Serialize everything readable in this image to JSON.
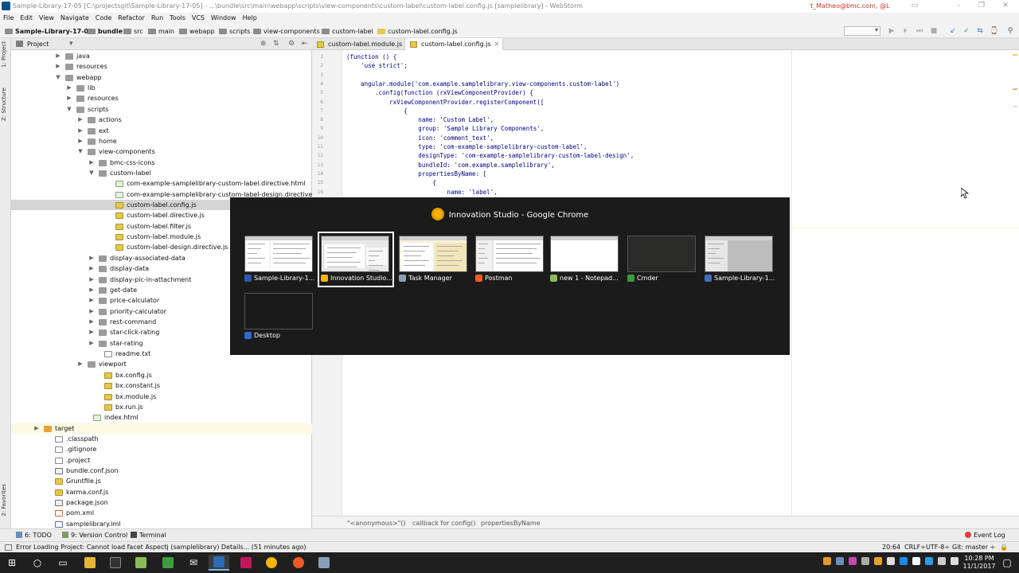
{
  "window": {
    "title": "Sample-Library-17-05 [C:\\projectsgit\\Sample-Library-17-05] - ...\\bundle\\src\\main\\webapp\\scripts\\view-components\\custom-label\\custom-label.config.js [samplelibrary] - WebStorm",
    "user": "t_Matheo@bmc.com, @L"
  },
  "menu": [
    "File",
    "Edit",
    "View",
    "Navigate",
    "Code",
    "Refactor",
    "Run",
    "Tools",
    "VCS",
    "Window",
    "Help"
  ],
  "breadcrumbs": [
    "Sample-Library-17-05",
    "bundle",
    "src",
    "main",
    "webapp",
    "scripts",
    "view-components",
    "custom-label",
    "custom-label.config.js"
  ],
  "project_panel": {
    "title": "Project",
    "tree": [
      {
        "label": "java",
        "icon": "folder",
        "arrow": "▶"
      },
      {
        "label": "resources",
        "icon": "folder",
        "arrow": "▶"
      },
      {
        "label": "webapp",
        "icon": "folder",
        "arrow": "▼"
      },
      {
        "label": "lib",
        "icon": "folder",
        "arrow": "▶"
      },
      {
        "label": "resources",
        "icon": "folder",
        "arrow": "▶"
      },
      {
        "label": "scripts",
        "icon": "folder",
        "arrow": "▼"
      },
      {
        "label": "actions",
        "icon": "folder",
        "arrow": "▶"
      },
      {
        "label": "ext",
        "icon": "folder",
        "arrow": "▶"
      },
      {
        "label": "home",
        "icon": "folder",
        "arrow": "▶"
      },
      {
        "label": "view-components",
        "icon": "folder",
        "arrow": "▼"
      },
      {
        "label": "bmc-css-icons",
        "icon": "folder",
        "arrow": "▶"
      },
      {
        "label": "custom-label",
        "icon": "folder",
        "arrow": "▼"
      },
      {
        "label": "com-example-samplelibrary-custom-label.directive.html",
        "icon": "html",
        "arrow": ""
      },
      {
        "label": "com-example-samplelibrary-custom-label-design.directive.html",
        "icon": "html",
        "arrow": ""
      },
      {
        "label": "custom-label.config.js",
        "icon": "js",
        "arrow": "",
        "selected": true
      },
      {
        "label": "custom-label.directive.js",
        "icon": "js",
        "arrow": ""
      },
      {
        "label": "custom-label.filter.js",
        "icon": "js",
        "arrow": ""
      },
      {
        "label": "custom-label.module.js",
        "icon": "js",
        "arrow": ""
      },
      {
        "label": "custom-label-design.directive.js",
        "icon": "js",
        "arrow": ""
      },
      {
        "label": "display-associated-data",
        "icon": "folder",
        "arrow": "▶"
      },
      {
        "label": "display-data",
        "icon": "folder",
        "arrow": "▶"
      },
      {
        "label": "display-pic-in-attachment",
        "icon": "folder",
        "arrow": "▶"
      },
      {
        "label": "get-date",
        "icon": "folder",
        "arrow": "▶"
      },
      {
        "label": "price-calculator",
        "icon": "folder",
        "arrow": "▶"
      },
      {
        "label": "priority-calculator",
        "icon": "folder",
        "arrow": "▶"
      },
      {
        "label": "rest-command",
        "icon": "folder",
        "arrow": "▶"
      },
      {
        "label": "star-click-rating",
        "icon": "folder",
        "arrow": "▶"
      },
      {
        "label": "star-rating",
        "icon": "folder",
        "arrow": "▶"
      },
      {
        "label": "readme.txt",
        "icon": "txt",
        "arrow": ""
      },
      {
        "label": "viewport",
        "icon": "folder",
        "arrow": "▶"
      },
      {
        "label": "bx.config.js",
        "icon": "js",
        "arrow": ""
      },
      {
        "label": "bx.constant.js",
        "icon": "js",
        "arrow": ""
      },
      {
        "label": "bx.module.js",
        "icon": "js",
        "arrow": ""
      },
      {
        "label": "bx.run.js",
        "icon": "js",
        "arrow": ""
      },
      {
        "label": "index.html",
        "icon": "html",
        "arrow": ""
      },
      {
        "label": "target",
        "icon": "folder-orange",
        "arrow": "▶",
        "highlight": true
      },
      {
        "label": ".classpath",
        "icon": "txt",
        "arrow": ""
      },
      {
        "label": ".gitignore",
        "icon": "txt",
        "arrow": ""
      },
      {
        "label": ".project",
        "icon": "txt",
        "arrow": ""
      },
      {
        "label": "bundle.conf.json",
        "icon": "json",
        "arrow": ""
      },
      {
        "label": "Gruntfile.js",
        "icon": "js",
        "arrow": ""
      },
      {
        "label": "karma.conf.js",
        "icon": "js",
        "arrow": ""
      },
      {
        "label": "package.json",
        "icon": "json",
        "arrow": ""
      },
      {
        "label": "pom.xml",
        "icon": "xml",
        "arrow": ""
      },
      {
        "label": "samplelibrary.iml",
        "icon": "iml",
        "arrow": ""
      }
    ]
  },
  "editor": {
    "tabs": [
      {
        "label": "custom-label.module.js",
        "active": false
      },
      {
        "label": "custom-label.config.js",
        "active": true
      }
    ],
    "line_numbers": [
      "1",
      "2",
      "3",
      "4",
      "5",
      "6",
      "7",
      "8",
      "9",
      "10",
      "11",
      "12",
      "13",
      "14",
      "15",
      "16"
    ],
    "code_lines": [
      "(function () {",
      "    'use strict';",
      "",
      "    angular.module('com.example.samplelibrary.view-components.custom-label')",
      "        .config(function (rxViewComponentProvider) {",
      "            rxViewComponentProvider.registerComponent([",
      "                {",
      "                    name: 'Custom Label',",
      "                    group: 'Sample Library Components',",
      "                    icon: 'comment_text',",
      "                    type: 'com-example-samplelibrary-custom-label',",
      "                    designType: 'com-example-samplelibrary-custom-label-design',",
      "                    bundleId: 'com.example.samplelibrary',",
      "                    propertiesByName: [",
      "                        {",
      "                            name: 'label',"
    ],
    "breadcrumbs": [
      "\"<anonymous>\"()",
      "callback for config()",
      "propertiesByName"
    ]
  },
  "task_switcher": {
    "title": "Innovation Studio - Google Chrome",
    "windows": [
      {
        "label": "Sample-Library-1...",
        "icon_color": "#2a5caa"
      },
      {
        "label": "Innovation Studio...",
        "icon_color": "#f4b400",
        "selected": true
      },
      {
        "label": "Task Manager",
        "icon_color": "#8aa0b8"
      },
      {
        "label": "Postman",
        "icon_color": "#ef5b25"
      },
      {
        "label": "new 1 - Notepad...",
        "icon_color": "#8dbb5a"
      },
      {
        "label": "Cmder",
        "icon_color": "#3e9b3e"
      },
      {
        "label": "Sample-Library-1...",
        "icon_color": "#3f6fb8"
      },
      {
        "label": "Desktop",
        "icon_color": "#2f6bd0"
      }
    ]
  },
  "tool_windows": {
    "todo": "6: TODO",
    "version_control": "9: Version Control",
    "terminal": "Terminal",
    "event_log": "Event Log"
  },
  "status": {
    "message": "Error Loading Project: Cannot load facet Aspectj (samplelibrary) Details... (51 minutes ago)",
    "position": "20:64",
    "line_sep": "CRLF÷",
    "encoding": "UTF-8÷",
    "git": "Git: master ÷"
  },
  "side_labels": {
    "project": "1: Project",
    "structure": "Z: Structure",
    "favorites": "2: Favorites"
  },
  "clock": {
    "time": "10:28 PM",
    "date": "11/1/2017"
  }
}
